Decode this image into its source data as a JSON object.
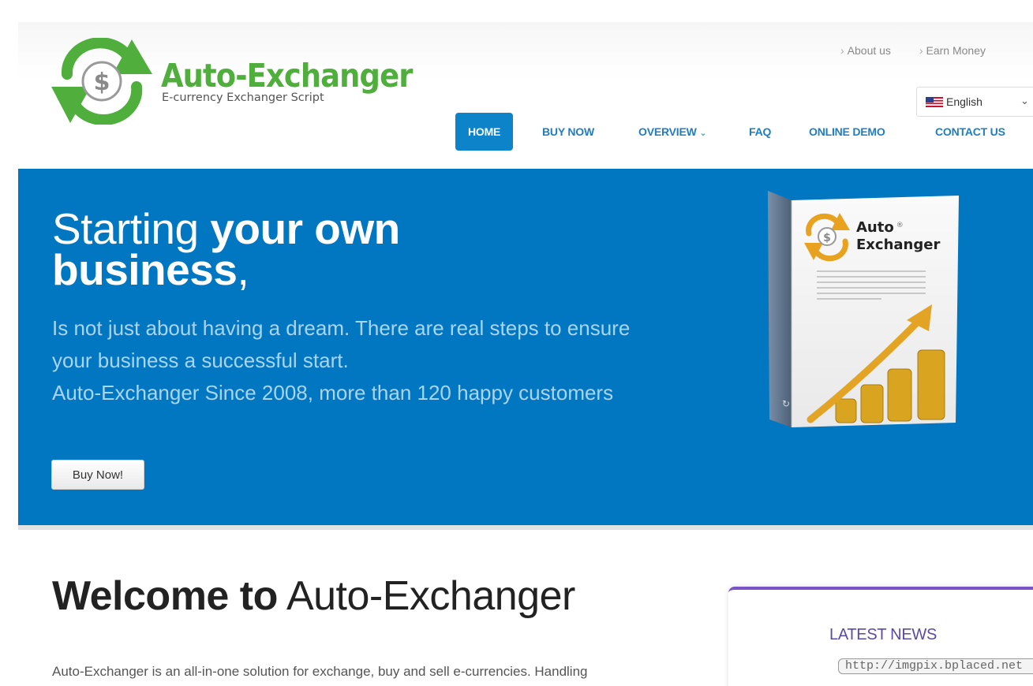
{
  "header": {
    "logo": {
      "title": "Auto-Exchanger",
      "subtitle": "E-currency Exchanger Script"
    },
    "top_links": [
      {
        "label": "About us"
      },
      {
        "label": "Earn Money"
      }
    ],
    "language": {
      "selected": "English"
    },
    "nav": [
      {
        "label": "HOME",
        "active": true
      },
      {
        "label": "BUY NOW"
      },
      {
        "label": "OVERVIEW"
      },
      {
        "label": "FAQ"
      },
      {
        "label": "ONLINE DEMO"
      },
      {
        "label": "CONTACT US"
      }
    ]
  },
  "hero": {
    "title_light": "Starting ",
    "title_bold_1": "your own",
    "title_bold_2": "business",
    "title_comma": ",",
    "line_1": "Is not just about having a dream. There are real steps to ensure your business a successful start.",
    "line_2": "Auto-Exchanger  Since 2008, more than 120 happy customers",
    "button": "Buy Now!",
    "product_box": {
      "line_1": "Auto",
      "line_2": "Exchanger",
      "mark": "®"
    }
  },
  "content": {
    "welcome_bold": "Welcome to",
    "welcome_rest": " Auto-Exchanger",
    "intro": "Auto-Exchanger is an all-in-one solution for exchange, buy and sell e-currencies. Handling"
  },
  "news": {
    "title": "LATEST NEWS",
    "link": "http://imgpix.bplaced.net"
  },
  "colors": {
    "brand_green": "#4fae3c",
    "nav_blue": "#1f7ec0",
    "nav_active": "#0d83c9",
    "hero_blue": "#0077c0",
    "news_purple": "#7a54c6"
  }
}
